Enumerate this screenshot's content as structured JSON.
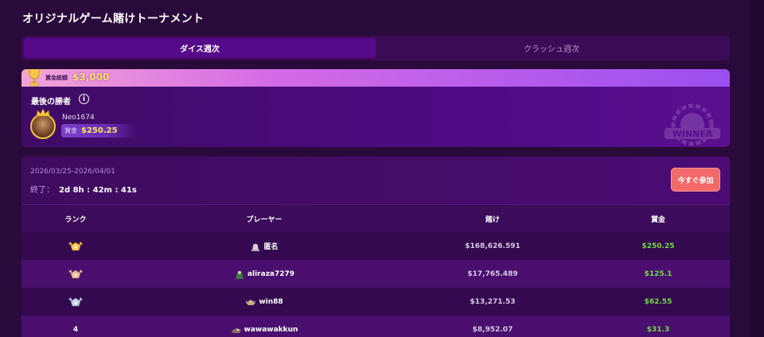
{
  "page": {
    "title": "オリジナルゲーム賭けトーナメント"
  },
  "tabs": [
    {
      "label": "ダイス週次",
      "active": true
    },
    {
      "label": "クラッシュ週次",
      "active": false
    }
  ],
  "winner_card": {
    "prize_pool_label": "賞金総額",
    "prize_pool_amount": "$3,000",
    "last_winner_label": "最後の勝者",
    "info_icon": "info-icon",
    "winner_name": "Neo1674",
    "prize_label": "賞金",
    "prize_amount": "$250.25",
    "badge_text": "WINNER"
  },
  "leaderboard": {
    "date_range": "2026/03/25-2026/04/01",
    "end_label": "終了：",
    "countdown": "2d 8h : 42m : 41s",
    "join_button": "今すぐ参加",
    "columns": {
      "rank": "ランク",
      "player": "プレーヤー",
      "wager": "賭け",
      "prize": "賞金"
    },
    "rows": [
      {
        "rank": "",
        "medal": "gold-medal-icon",
        "player": "匿名",
        "wager": "$168,626.591",
        "prize": "$250.25"
      },
      {
        "rank": "",
        "medal": "silver-medal-icon",
        "player": "aliraza7279",
        "wager": "$17,765.489",
        "prize": "$125.1"
      },
      {
        "rank": "",
        "medal": "bronze-medal-icon",
        "player": "win88",
        "wager": "$13,271.53",
        "prize": "$62.55"
      },
      {
        "rank": "4",
        "medal": "",
        "player": "wawawakkun",
        "wager": "$8,952.07",
        "prize": "$31.3"
      }
    ]
  },
  "colors": {
    "background": "#2a0a3a",
    "accent_purple": "#560a8a",
    "prize_gold": "#fbe36a",
    "prize_green": "#6fdc3f",
    "join_button": "#f26a6a"
  }
}
